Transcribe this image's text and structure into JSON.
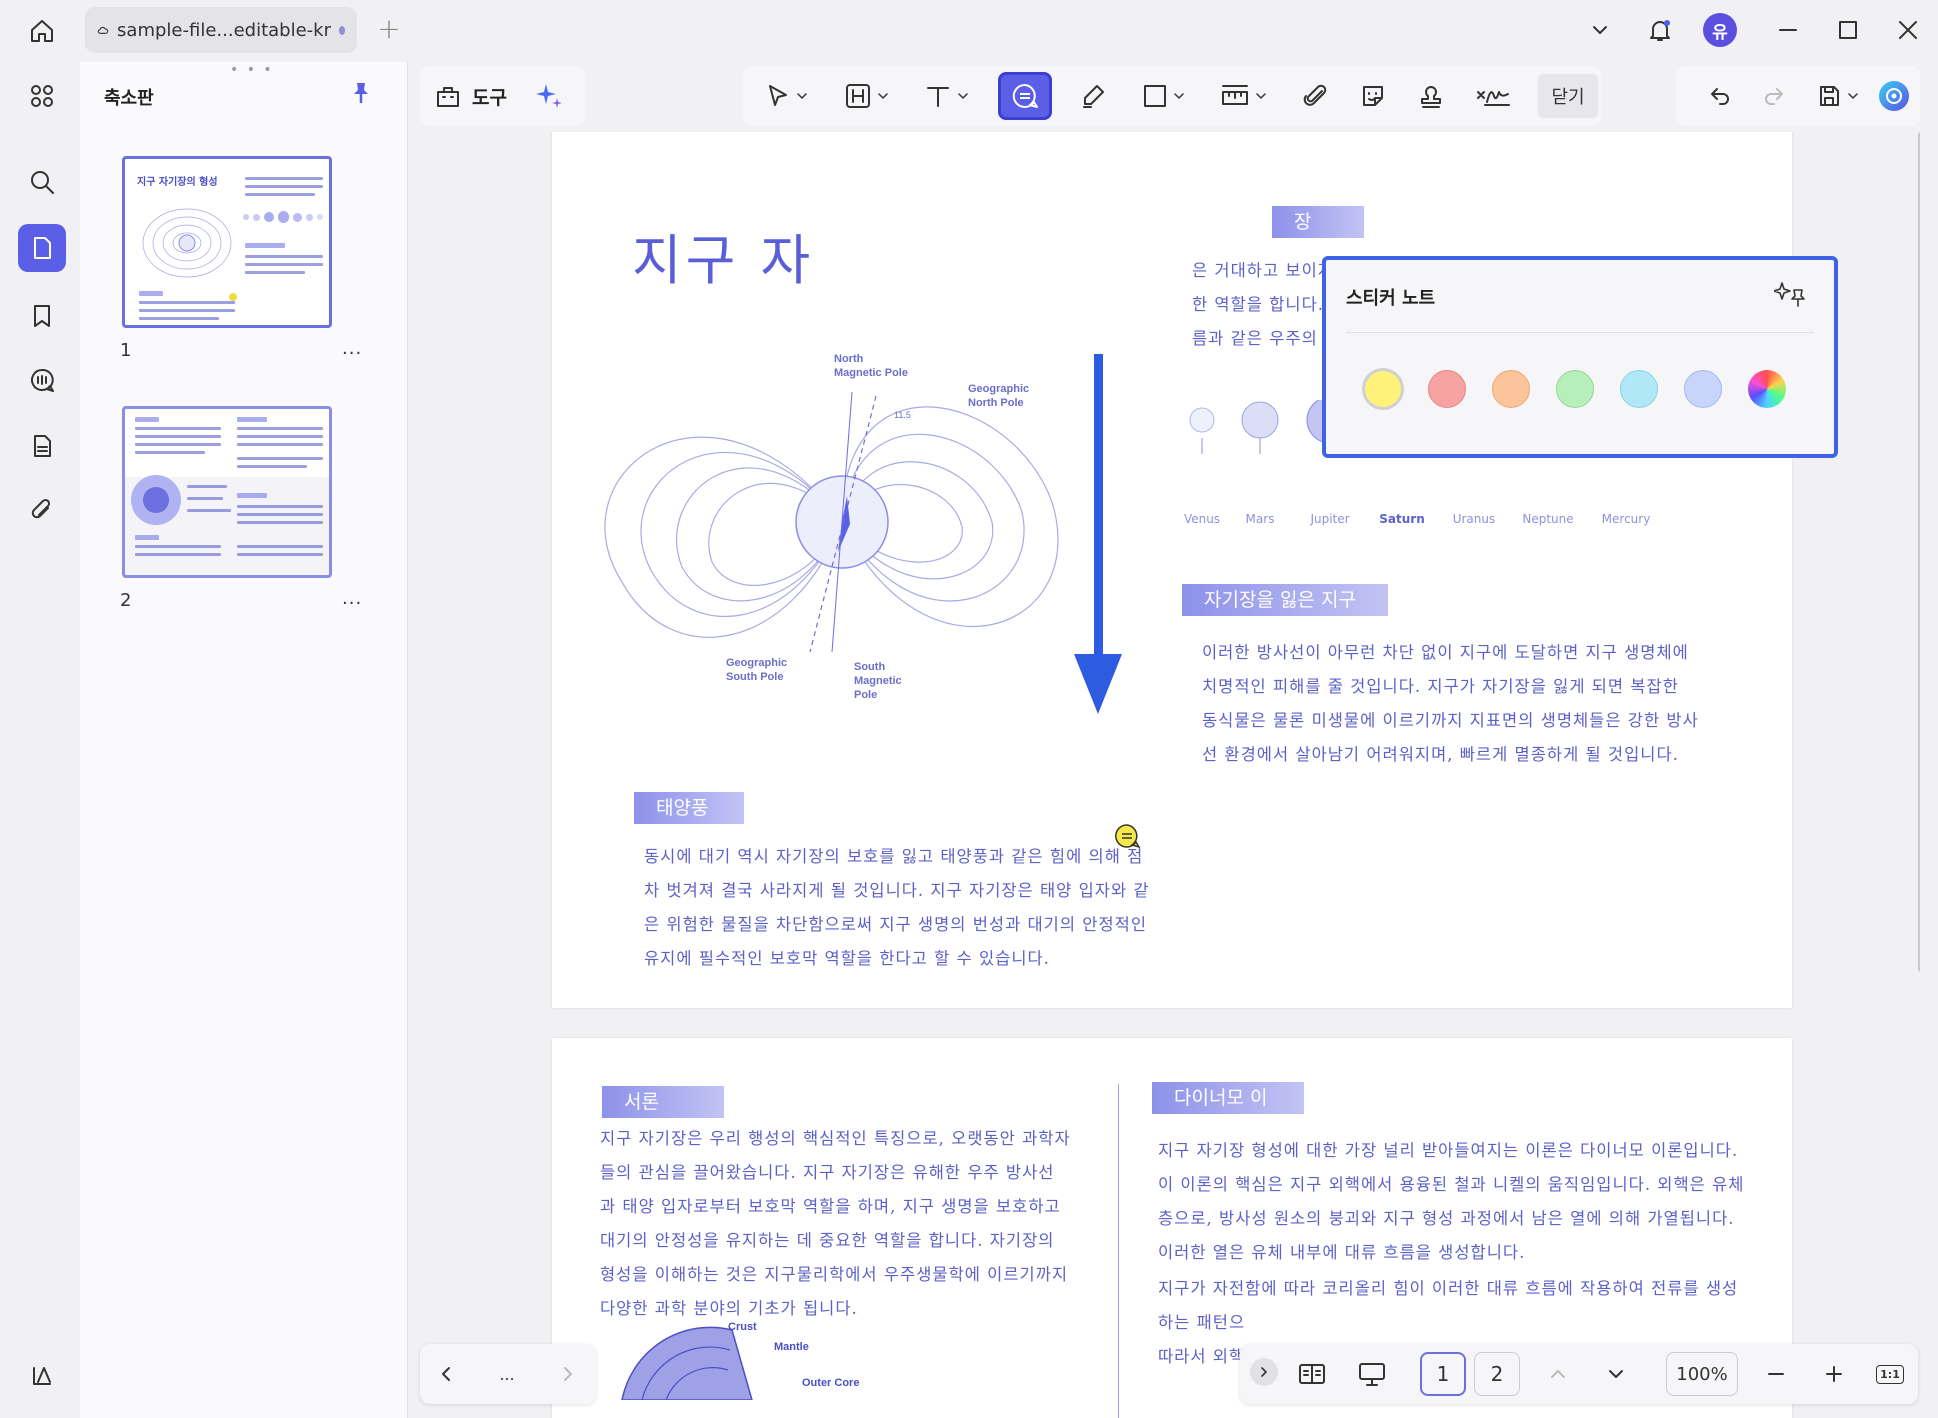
{
  "tab": {
    "title": "sample-file...editable-kr",
    "add": "+"
  },
  "user": {
    "avatar_letter": "유"
  },
  "panel": {
    "title": "축소판",
    "more": "...",
    "pages": [
      "1",
      "2"
    ]
  },
  "toolbar": {
    "tools_label": "도구",
    "close_label": "닫기"
  },
  "sticky": {
    "title": "스티커 노트",
    "colors": [
      "#fff27a",
      "#f7a3a3",
      "#fbc49a",
      "#b6efb9",
      "#b1e8f7",
      "#c7d5fb",
      "rainbow"
    ]
  },
  "page1": {
    "title": "지구 자",
    "tag1": "장",
    "para1": [
      "은 거대하고 보이지 않는 보호막과 같으며, 우주 환경에",
      "한 역할을 합니다. 지구 자기장은 고에너지 하전 입자호",
      "름과 같은 우주의 다양한 방사선 대부분을 효과적으로 차단합니다."
    ],
    "planets": [
      "Venus",
      "Mars",
      "Jupiter",
      "Saturn",
      "Uranus",
      "Neptune",
      "Mercury"
    ],
    "tag2": "자기장을 잃은 지구",
    "para2": [
      "이러한 방사선이 아무런 차단 없이 지구에 도달하면 지구 생명체에",
      "치명적인 피해를 줄 것입니다. 지구가 자기장을 잃게 되면 복잡한",
      "동식물은 물론 미생물에 이르기까지 지표면의 생명체들은 강한 방사",
      "선 환경에서 살아남기 어려워지며, 빠르게 멸종하게 될 것입니다."
    ],
    "tag3": "태양풍",
    "para3": [
      "동시에 대기 역시 자기장의 보호를 잃고 태양풍과 같은 힘에 의해 점",
      "차 벗겨져 결국 사라지게 될 것입니다. 지구 자기장은 태양 입자와 같",
      "은 위험한 물질을 차단함으로써 지구 생명의 번성과 대기의 안정적인",
      "유지에 필수적인 보호막 역할을 한다고 할 수 있습니다."
    ],
    "diagram": {
      "north_mag": [
        "North",
        "Magnetic Pole"
      ],
      "geo_north": [
        "Geographic",
        "North Pole"
      ],
      "geo_south": [
        "Geographic",
        "South Pole"
      ],
      "south_mag": [
        "South",
        "Magnetic",
        "Pole"
      ],
      "angle": "11.5"
    }
  },
  "page2": {
    "tag1": "서론",
    "para1": [
      "지구 자기장은 우리 행성의 핵심적인 특징으로, 오랫동안 과학자",
      "들의 관심을 끌어왔습니다. 지구 자기장은 유해한 우주 방사선",
      "과 태양 입자로부터 보호막 역할을 하며, 지구 생명을 보호하고",
      "대기의 안정성을 유지하는 데 중요한 역할을 합니다. 자기장의",
      "형성을 이해하는 것은 지구물리학에서 우주생물학에 이르기까지",
      "다양한 과학 분야의 기초가 됩니다."
    ],
    "tag2": "다이너모 이론",
    "para2": [
      "지구 자기장 형성에 대한 가장 널리 받아들여지는 이론은 다이너모 이론입니다.",
      "이 이론의 핵심은 지구 외핵에서 용융된 철과 니켈의 움직임입니다. 외핵은 유체",
      "층으로, 방사성 원소의 붕괴와 지구 형성 과정에서 남은 열에 의해 가열됩니다.",
      "이러한 열은 유체 내부에 대류 흐름을 생성합니다."
    ],
    "para3": [
      "지구가 자전함에 따라 코리올리 힘이 이러한 대류 흐름에 작용하여 전류를 생성",
      "하는 패턴으",
      "따라서 외핵"
    ],
    "layers": [
      "Crust",
      "Mantle",
      "Outer Core"
    ]
  },
  "nav": {
    "more": "..."
  },
  "zoom": {
    "page1": "1",
    "page2": "2",
    "value": "100%",
    "fit": "1:1"
  }
}
